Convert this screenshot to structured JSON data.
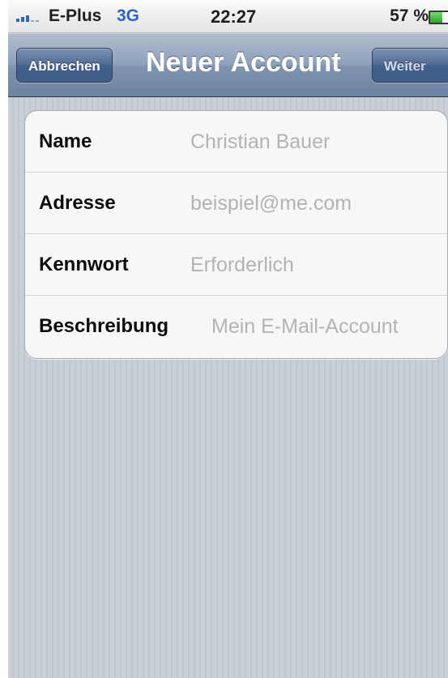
{
  "status_bar": {
    "carrier": "E-Plus",
    "network": "3G",
    "time": "22:27",
    "battery_text": "57 %",
    "battery_level": 0.57,
    "signal_bars_active": 3,
    "signal_bars_total": 5,
    "colors": {
      "network": "#2b66c5",
      "battery_fill": "#2fa52c"
    }
  },
  "nav_bar": {
    "title": "Neuer Account",
    "cancel_label": "Abbrechen",
    "next_label": "Weiter",
    "next_enabled": false
  },
  "form": {
    "fields": [
      {
        "label": "Name",
        "placeholder": "Christian Bauer",
        "value": ""
      },
      {
        "label": "Adresse",
        "placeholder": "beispiel@me.com",
        "value": ""
      },
      {
        "label": "Kennwort",
        "placeholder": "Erforderlich",
        "value": ""
      },
      {
        "label": "Beschreibung",
        "placeholder": "Mein E-Mail-Account",
        "value": ""
      }
    ]
  }
}
